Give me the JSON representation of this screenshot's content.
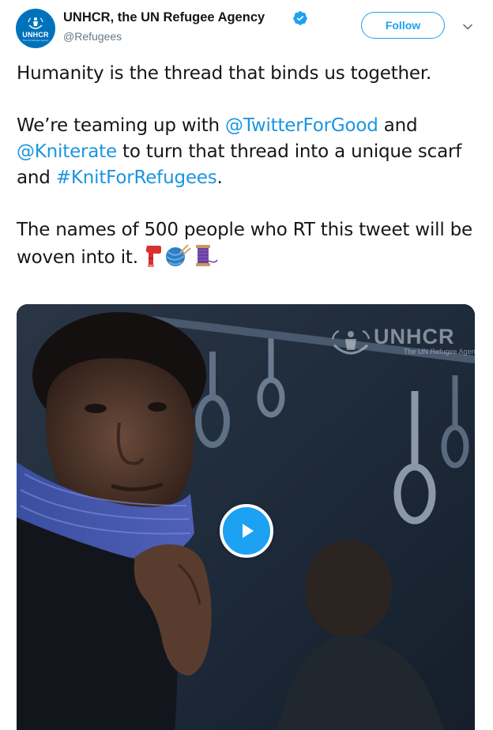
{
  "author": {
    "display_name": "UNHCR, the UN Refugee Agency",
    "handle": "@Refugees",
    "avatar_text": "UNHCR",
    "avatar_subtext": "The UN Refugee Agency",
    "verified": true
  },
  "actions": {
    "follow_label": "Follow"
  },
  "tweet": {
    "line1": "Humanity is the thread that binds us together.",
    "p2_prefix": "We’re teaming up with ",
    "mention1": "@TwitterForGood",
    "p2_and": " and ",
    "mention2": "@Kniterate",
    "p2_middle": " to turn that thread into a unique scarf and ",
    "hashtag": "#KnitForRefugees",
    "p2_suffix": ".",
    "p3_text": "The names of 500 people who RT this tweet will be woven into it. ",
    "emojis": [
      "scarf-emoji",
      "yarn-emoji",
      "thread-emoji"
    ]
  },
  "media": {
    "type": "video",
    "watermark_text": "UNHCR",
    "watermark_subtext": "The UN Refugee Agency"
  },
  "colors": {
    "accent": "#1da1f2",
    "link": "#1b95e0",
    "text": "#14171a",
    "secondary": "#657786",
    "unhcr_blue": "#0072bc"
  }
}
